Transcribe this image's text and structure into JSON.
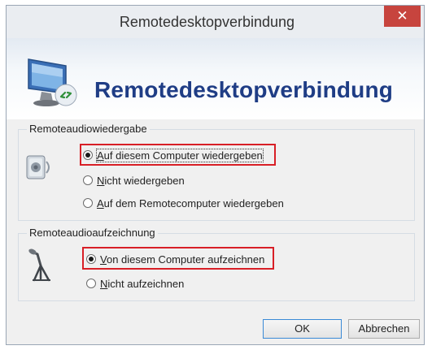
{
  "window": {
    "title": "Remotedesktopverbindung",
    "close_glyph": "✕"
  },
  "header": {
    "title": "Remotedesktopverbindung",
    "icon": "remote-desktop-monitor-icon"
  },
  "audio_playback": {
    "label": "Remoteaudiowiedergabe",
    "icon": "speaker-icon",
    "options": [
      {
        "access_key": "A",
        "rest": "uf diesem Computer wiedergeben",
        "selected": true
      },
      {
        "access_key": "N",
        "rest": "icht wiedergeben",
        "selected": false
      },
      {
        "access_key": "A",
        "rest": "uf dem Remotecomputer wiedergeben",
        "selected": false
      }
    ]
  },
  "audio_recording": {
    "label": "Remoteaudioaufzeichnung",
    "icon": "microphone-icon",
    "options": [
      {
        "access_key": "V",
        "rest": "on diesem Computer aufzeichnen",
        "selected": true
      },
      {
        "access_key": "N",
        "rest": "icht aufzeichnen",
        "selected": false
      }
    ]
  },
  "buttons": {
    "ok": "OK",
    "cancel": "Abbrechen"
  },
  "colors": {
    "highlight": "#d81f26",
    "title_blue": "#1f3d85",
    "close_red": "#c7443e"
  }
}
